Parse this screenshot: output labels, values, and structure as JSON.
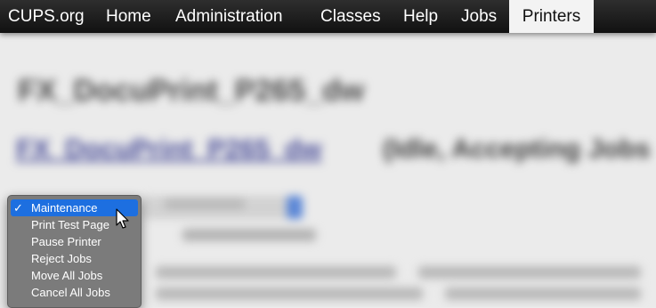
{
  "navbar": {
    "brand": "CUPS.org",
    "items": [
      {
        "label": "Home"
      },
      {
        "label": "Administration"
      },
      {
        "label": "Classes"
      },
      {
        "label": "Help"
      },
      {
        "label": "Jobs"
      },
      {
        "label": "Printers",
        "active": true
      }
    ]
  },
  "menu": {
    "items": [
      {
        "label": "Maintenance",
        "selected": true
      },
      {
        "label": "Print Test Page"
      },
      {
        "label": "Pause Printer"
      },
      {
        "label": "Reject Jobs"
      },
      {
        "label": "Move All Jobs"
      },
      {
        "label": "Cancel All Jobs"
      }
    ],
    "check_glyph": "✓"
  },
  "page": {
    "heading": "FX_DocuPrint_P265_dw",
    "printer_link": "FX_DocuPrint_P265_dw",
    "printer_status": "(Idle, Accepting Jobs"
  },
  "colors": {
    "navbar_bg": "#1c1c1c",
    "active_tab_bg": "#f3f3f3",
    "menu_bg": "#7b7b7b",
    "menu_selected": "#1d6fe0",
    "link": "#4b4f9a"
  }
}
